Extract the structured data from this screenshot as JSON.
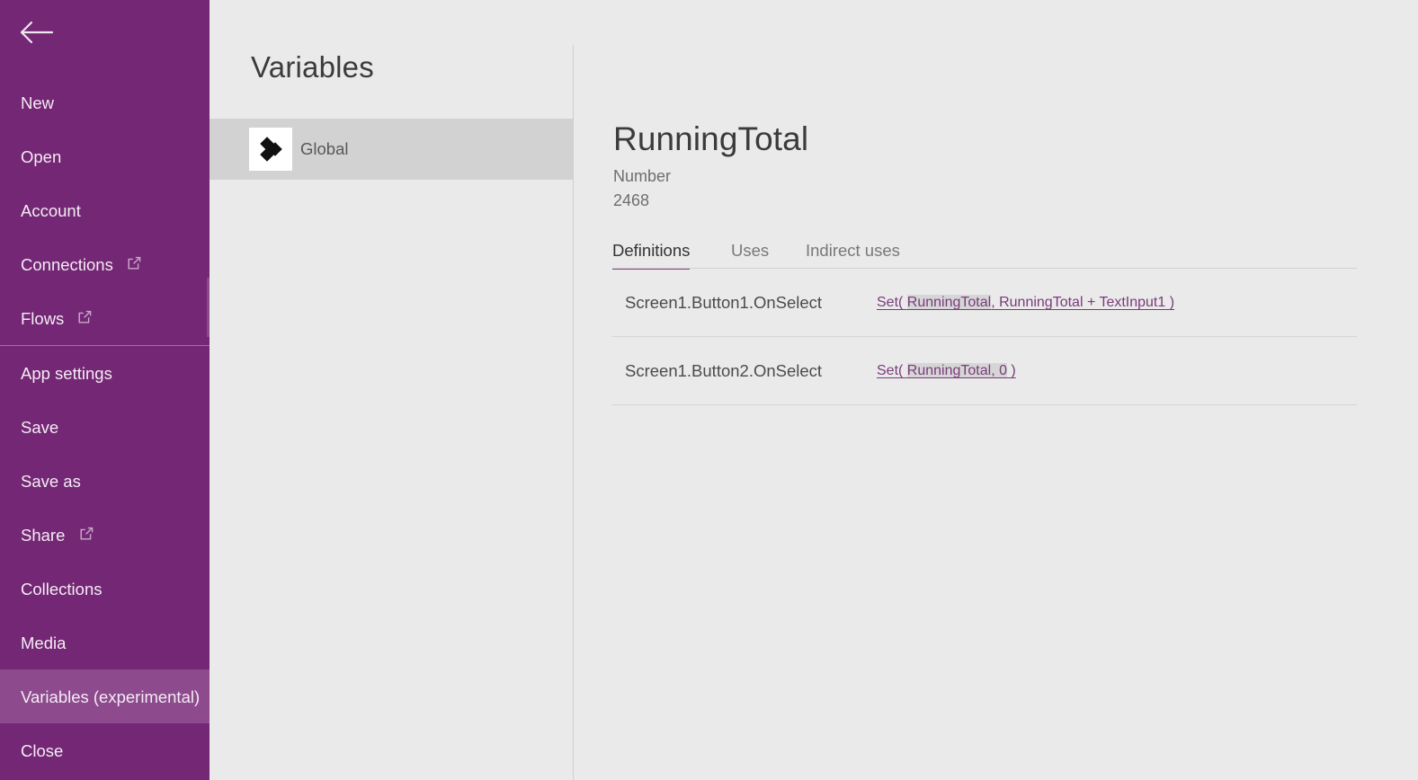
{
  "sidebar": {
    "background_color": "#742774",
    "selected_color": "#8D4A8D",
    "back_button": {
      "icon": "arrow-left-icon",
      "label": "Back"
    },
    "items": [
      {
        "label": "New",
        "external": false,
        "selected": false
      },
      {
        "label": "Open",
        "external": false,
        "selected": false
      },
      {
        "label": "Account",
        "external": false,
        "selected": false
      },
      {
        "label": "Connections",
        "external": true,
        "selected": false
      },
      {
        "label": "Flows",
        "external": true,
        "selected": false
      },
      {
        "label": "App settings",
        "external": false,
        "selected": false
      },
      {
        "label": "Save",
        "external": false,
        "selected": false
      },
      {
        "label": "Save as",
        "external": false,
        "selected": false
      },
      {
        "label": "Share",
        "external": true,
        "selected": false
      },
      {
        "label": "Collections",
        "external": false,
        "selected": false
      },
      {
        "label": "Media",
        "external": false,
        "selected": false
      },
      {
        "label": "Variables (experimental)",
        "external": false,
        "selected": true
      },
      {
        "label": "Close",
        "external": false,
        "selected": false
      }
    ],
    "divider_after_index": 4
  },
  "variables_pane": {
    "title": "Variables",
    "items": [
      {
        "label": "Global",
        "icon": "diamonds-icon",
        "selected": true
      }
    ]
  },
  "detail": {
    "name": "RunningTotal",
    "type": "Number",
    "value": "2468",
    "tabs": [
      {
        "label": "Definitions",
        "active": true
      },
      {
        "label": "Uses",
        "active": false
      },
      {
        "label": "Indirect uses",
        "active": false
      }
    ],
    "accent_color": "#8A3D8A",
    "link_color": "#7A3B7A",
    "definitions": [
      {
        "target": "Screen1.Button1.OnSelect",
        "formula_prefix": "Set( ",
        "formula_highlight": "RunningTotal",
        "formula_suffix": ", RunningTotal + TextInput1 )",
        "formula_full": "Set( RunningTotal, RunningTotal + TextInput1 )"
      },
      {
        "target": "Screen1.Button2.OnSelect",
        "formula_prefix": "Set( ",
        "formula_highlight": "RunningTotal, 0",
        "formula_suffix": " )",
        "formula_full": "Set( RunningTotal, 0 )"
      }
    ]
  }
}
